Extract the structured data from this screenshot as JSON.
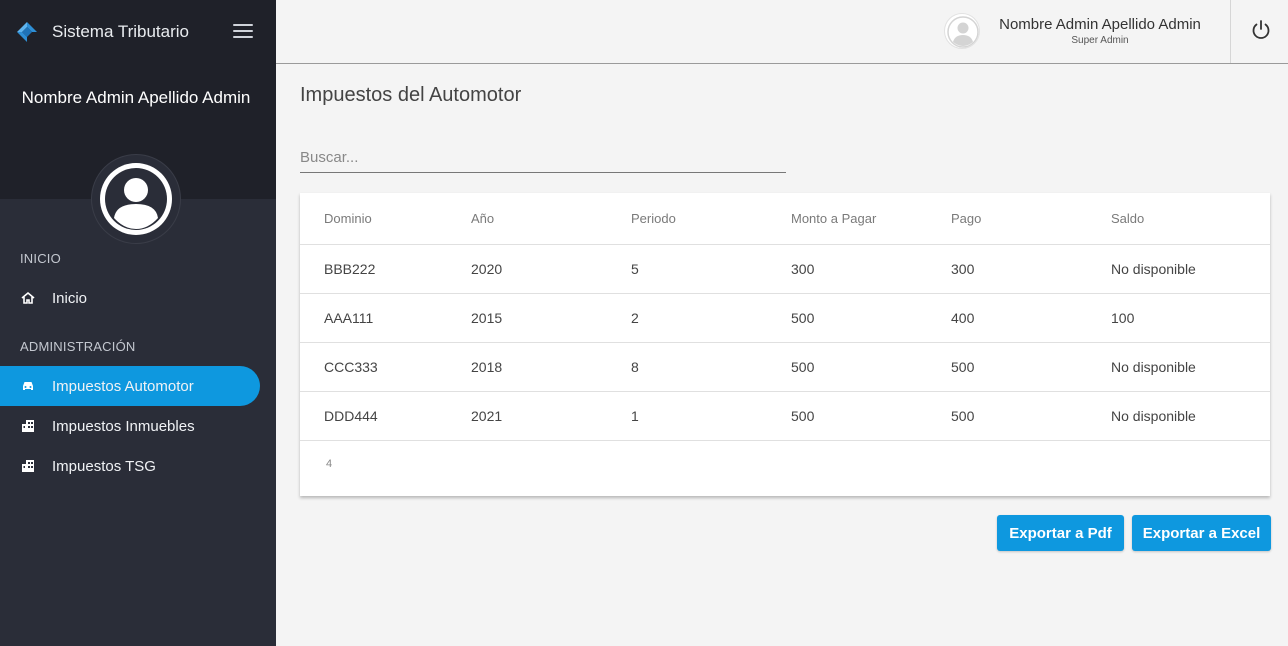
{
  "app": {
    "title": "Sistema Tributario"
  },
  "sidebar": {
    "username": "Nombre Admin Apellido Admin",
    "sections": [
      {
        "label": "INICIO"
      },
      {
        "label": "ADMINISTRACIÓN"
      }
    ],
    "items": [
      {
        "label": "Inicio",
        "icon": "home-icon"
      },
      {
        "label": "Impuestos Automotor",
        "icon": "car-icon",
        "active": true
      },
      {
        "label": "Impuestos Inmuebles",
        "icon": "building-icon"
      },
      {
        "label": "Impuestos TSG",
        "icon": "building-icon"
      }
    ]
  },
  "header": {
    "user_name": "Nombre Admin Apellido Admin",
    "user_role": "Super Admin",
    "logout_icon": "power-icon"
  },
  "main": {
    "title": "Impuestos del Automotor",
    "search": {
      "placeholder": "Buscar...",
      "value": ""
    },
    "table": {
      "headers": [
        "Dominio",
        "Año",
        "Periodo",
        "Monto a Pagar",
        "Pago",
        "Saldo"
      ],
      "rows": [
        [
          "BBB222",
          "2020",
          "5",
          "300",
          "300",
          "No disponible"
        ],
        [
          "AAA111",
          "2015",
          "2",
          "500",
          "400",
          "100"
        ],
        [
          "CCC333",
          "2018",
          "8",
          "500",
          "500",
          "No disponible"
        ],
        [
          "DDD444",
          "2021",
          "1",
          "500",
          "500",
          "No disponible"
        ]
      ],
      "footer_count": "4"
    },
    "buttons": {
      "export_pdf": "Exportar a Pdf",
      "export_excel": "Exportar a Excel"
    }
  },
  "colors": {
    "accent": "#0e98df",
    "sidebar_bg": "#2a2d38",
    "sidebar_top_bg": "#1f2129"
  }
}
